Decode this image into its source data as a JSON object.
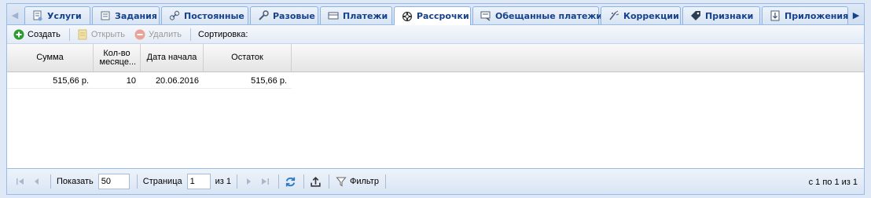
{
  "tabs": [
    {
      "label": "Услуги",
      "icon": "services-icon",
      "active": false
    },
    {
      "label": "Задания",
      "icon": "tasks-icon",
      "active": false
    },
    {
      "label": "Постоянные",
      "icon": "link-icon",
      "active": false
    },
    {
      "label": "Разовые",
      "icon": "wrench-icon",
      "active": false
    },
    {
      "label": "Платежи",
      "icon": "payments-icon",
      "active": false
    },
    {
      "label": "Рассрочки",
      "icon": "lifebuoy-icon",
      "active": true
    },
    {
      "label": "Обещанные платежи",
      "icon": "promised-payment-icon",
      "active": false
    },
    {
      "label": "Коррекции",
      "icon": "correction-icon",
      "active": false
    },
    {
      "label": "Признаки",
      "icon": "tag-icon",
      "active": false
    },
    {
      "label": "Приложения",
      "icon": "attachment-icon",
      "active": false
    }
  ],
  "toolbar": {
    "create_label": "Создать",
    "open_label": "Открыть",
    "delete_label": "Удалить",
    "sort_label": "Сортировка:"
  },
  "grid": {
    "columns": [
      "Сумма",
      "Кол-во месяце...",
      "Дата начала",
      "Остаток"
    ],
    "rows": [
      {
        "sum": "515,66 р.",
        "months": "10",
        "start_date": "20.06.2016",
        "remainder": "515,66 р."
      }
    ]
  },
  "pager": {
    "show_label": "Показать",
    "page_size": "50",
    "page_label": "Страница",
    "page_value": "1",
    "of_label": "из 1",
    "filter_label": "Фильтр",
    "summary": "с 1 по 1 из 1"
  },
  "colors": {
    "accent": "#15428b",
    "border": "#99bbe8",
    "create_green": "#2e9b2e",
    "delete_red": "#e36a5b"
  }
}
